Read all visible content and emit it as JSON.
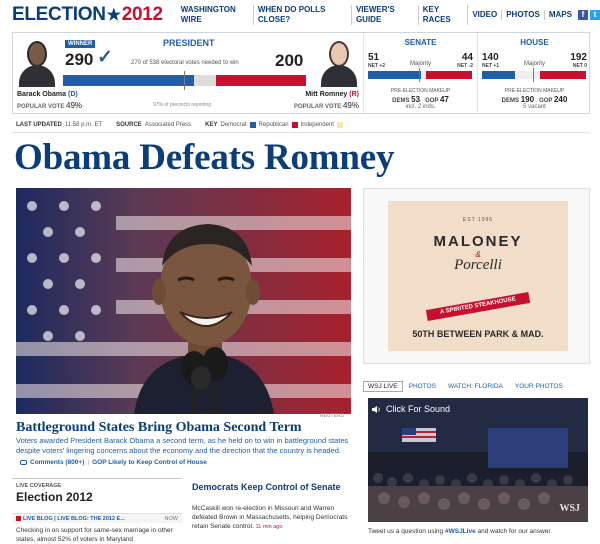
{
  "logo": {
    "part1": "ELECTION",
    "star": "★",
    "part2": "2012"
  },
  "nav": {
    "items": [
      "WASHINGTON WIRE",
      "WHEN DO POLLS CLOSE?",
      "VIEWER'S GUIDE",
      "KEY RACES",
      "VIDEO",
      "PHOTOS",
      "MAPS"
    ]
  },
  "colors": {
    "dem": "#1f5fa8",
    "rep": "#c8102e",
    "navy": "#0a3d7a",
    "independent": "#f3e9b5"
  },
  "president": {
    "title": "PRESIDENT",
    "winner_badge": "WINNER",
    "check": "✓",
    "obama_ev": "290",
    "romney_ev": "200",
    "needed_text": "270 of 538 electoral votes needed to win",
    "obama_ev_value": 290,
    "romney_ev_value": 200,
    "total_ev": 538,
    "precincts": "97% of precincts reporting",
    "obama_name": "Barack Obama",
    "obama_party": "(D)",
    "romney_name": "Mitt Romney",
    "romney_party": "(R)",
    "popvote_label": "POPULAR VOTE",
    "obama_pv": "49%",
    "romney_pv": "49%"
  },
  "senate": {
    "title": "SENATE",
    "dem": "51",
    "dem_net": "NET +2",
    "rep": "44",
    "rep_net": "NET -2",
    "majority": "Majority",
    "dem_value": 51,
    "rep_value": 44,
    "total": 100,
    "pre_label": "PRE-ELECTION MAKEUP",
    "pre_dem_label": "DEMS",
    "pre_dem": "53",
    "pre_gop_label": "GOP",
    "pre_gop": "47",
    "note": "incl. 2 inds."
  },
  "house": {
    "title": "HOUSE",
    "dem": "140",
    "dem_net": "NET +1",
    "rep": "192",
    "rep_net": "NET 0",
    "majority": "Majority",
    "dem_value": 140,
    "rep_value": 192,
    "total": 435,
    "pre_label": "PRE-ELECTION MAKEUP",
    "pre_dem_label": "DEMS",
    "pre_dem": "190",
    "pre_gop_label": "GOP",
    "pre_gop": "240",
    "note": "5 vacant"
  },
  "updated": {
    "label": "LAST UPDATED",
    "time": "11:58 p.m. ET",
    "source_label": "SOURCE",
    "source": "Associated Press",
    "key_label": "KEY",
    "key_dem": "Democrat",
    "key_rep": "Republican",
    "key_ind": "Independent"
  },
  "headline": "Obama Defeats Romney",
  "photo": {
    "credit": "REUTERS"
  },
  "story": {
    "title": "Battleground States Bring Obama Second Term",
    "text": "Voters awarded President Barack Obama a second term, as he held on to win in battleground states despite voters' lingering concerns about the economy and the direction that the country is headed.",
    "comments": "Comments (800+)",
    "related": "GOP Likely to Keep Control of House"
  },
  "live": {
    "label": "LIVE COVERAGE",
    "title": "Election 2012",
    "blog": "LIVE BLOG | LIVE BLOG: THE 2012 E...",
    "now": "NOW",
    "text": "Checking in on support for same-sex marriage in other states, almost 52% of voters in Maryland"
  },
  "mid_story": {
    "title": "Democrats Keep Control of Senate",
    "text": "McCaskill won re-election in Missouri and Warren defeated Brown in Massachusetts, helping Democrats retain Senate control.",
    "ago": "11 min ago"
  },
  "ad": {
    "est": "EST 1996",
    "name1": "MALONEY",
    "amp": "&",
    "name2": "Porcelli",
    "banner": "A SPIRITED STEAKHOUSE",
    "address": "50TH BETWEEN PARK & MAD."
  },
  "video": {
    "tabs": [
      "WSJ LIVE",
      "PHOTOS",
      "WATCH: FLORIDA",
      "YOUR PHOTOS"
    ],
    "caption": "Click For Sound",
    "mark": "WSJ",
    "tweet_pre": "Tweet us a question using",
    "tweet_tag": "#WSJLive",
    "tweet_post": "and watch for our answer."
  }
}
